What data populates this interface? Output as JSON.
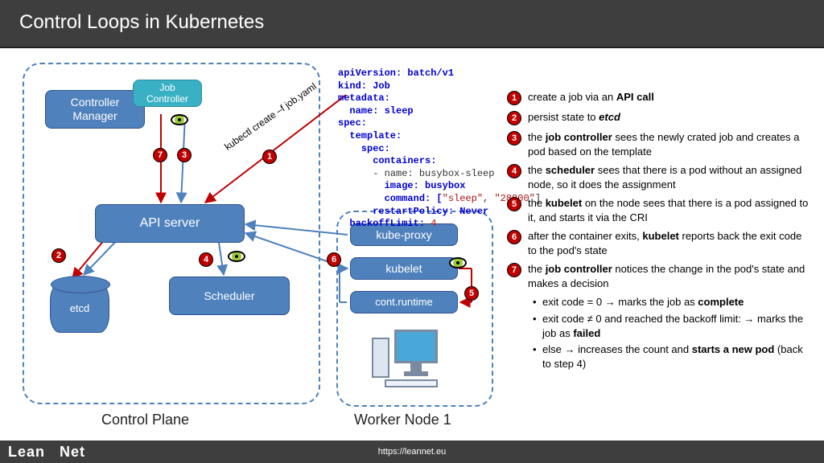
{
  "title": "Control Loops in Kubernetes",
  "footer": {
    "url": "https://leannet.eu",
    "brand_left": "Lean",
    "brand_right": "Net"
  },
  "labels": {
    "control_plane": "Control Plane",
    "worker_node": "Worker Node 1"
  },
  "boxes": {
    "controller_manager": "Controller\nManager",
    "job_controller": "Job\nController",
    "api_server": "API server",
    "scheduler": "Scheduler",
    "kube_proxy": "kube-proxy",
    "kubelet": "kubelet",
    "container_runtime": "cont.runtime",
    "etcd": "etcd"
  },
  "kubectl_cmd": "kubectl create –f job.yaml",
  "yaml": {
    "l1": "apiVersion: batch/v1",
    "l2": "kind: Job",
    "l3": "metadata:",
    "l4": "  name: sleep",
    "l5": "spec:",
    "l6": "  template:",
    "l7": "    spec:",
    "l8": "      containers:",
    "l9": "      - name: busybox-sleep",
    "l10": "        image: busybox",
    "l11a": "        command: [",
    "l11b": "\"sleep\"",
    "l11c": ", ",
    "l11d": "\"28800\"",
    "l11e": "]",
    "l12": "      restartPolicy: Never",
    "l13a": "  backoffLimit: ",
    "l13b": "4"
  },
  "steps": [
    "create a job via an <b>API call</b>",
    "persist state to <b><i>etcd</i></b>",
    "the <b>job controller</b> sees the newly crated job and creates a pod based on the template",
    "the <b>scheduler</b> sees that there is a pod without an assigned node, so it does the assignment",
    "the <b>kubelet</b> on the node sees that there is a pod assigned to it, and starts it via the CRI",
    "after the container exits, <b>kubelet</b> reports back the exit code to the pod's state",
    "the <b>job controller</b> notices the change in the pod's state and makes a decision"
  ],
  "bullets": [
    "exit code = 0 → marks the job as <b>complete</b>",
    "exit code ≠ 0 and reached the backoff limit: → marks the job as <b>failed</b>",
    "else → increases the count and <b>starts a new pod</b> (back to step 4)"
  ]
}
